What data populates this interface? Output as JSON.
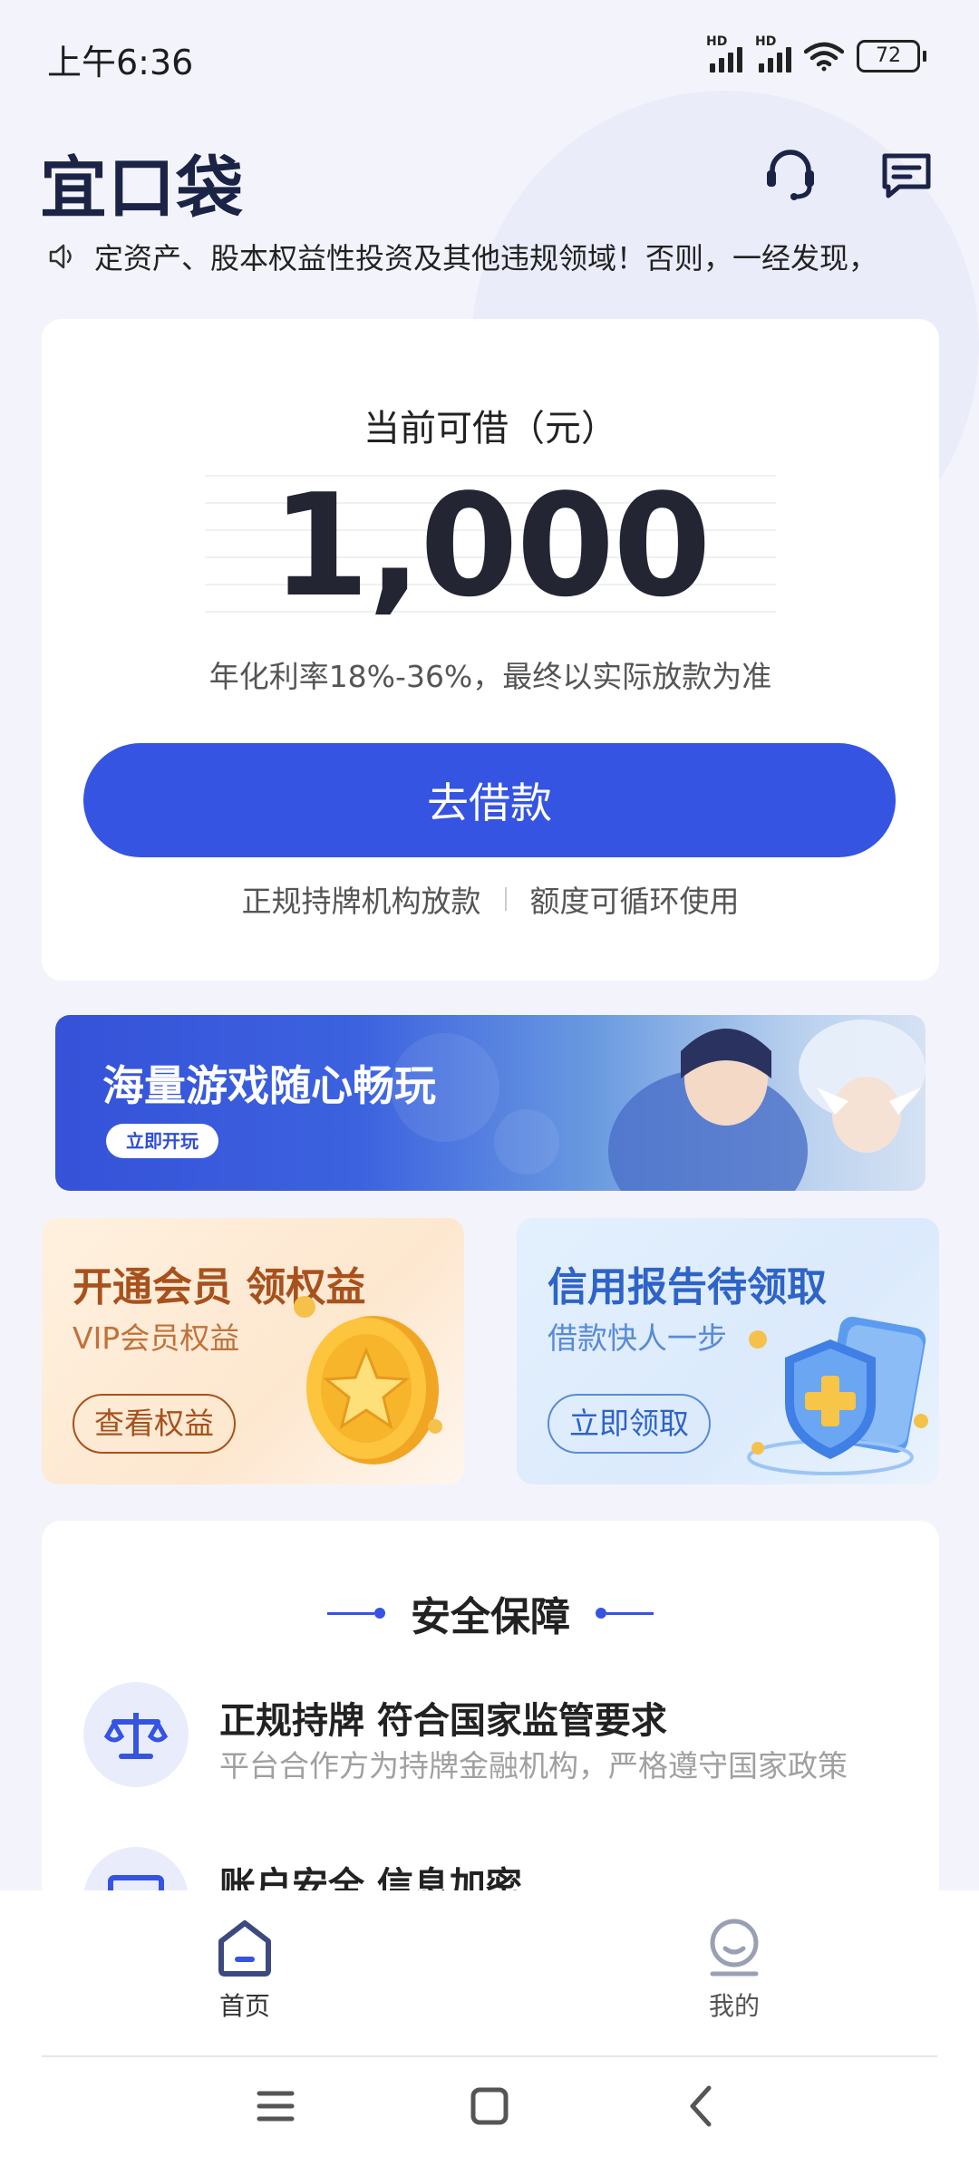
{
  "status_bar": {
    "time": "上午6:36",
    "hd_label": "HD",
    "battery": "72",
    "icons": [
      "signal-1-icon",
      "signal-2-icon",
      "wifi-icon",
      "battery-icon"
    ]
  },
  "header": {
    "logo": "宜口袋",
    "icons": [
      "customer-service-icon",
      "message-icon"
    ]
  },
  "notice": {
    "icon": "speaker-icon",
    "text": "定资产、股本权益性投资及其他违规领域！否则，一经发现，"
  },
  "loan_card": {
    "title": "当前可借（元）",
    "amount": "1,000",
    "rate_text": "年化利率18%-36%，最终以实际放款为准",
    "button_label": "去借款",
    "feature_1": "正规持牌机构放款",
    "feature_2": "额度可循环使用"
  },
  "game_banner": {
    "title": "海量游戏随心畅玩",
    "button_label": "立即开玩"
  },
  "promos": {
    "vip": {
      "title": "开通会员 领权益",
      "subtitle": "VIP会员权益",
      "button_label": "查看权益",
      "icon": "gold-coin-star-icon"
    },
    "credit": {
      "title": "信用报告待领取",
      "subtitle": "借款快人一步",
      "button_label": "立即领取",
      "icon": "shield-plus-icon"
    }
  },
  "security": {
    "title": "安全保障",
    "items": [
      {
        "title": "正规持牌 符合国家监管要求",
        "desc": "平台合作方为持牌金融机构，严格遵守国家政策",
        "icon": "scale-icon"
      },
      {
        "title": "账户安全 信息加密",
        "desc": "",
        "icon": "id-card-icon"
      }
    ]
  },
  "tabbar": {
    "home_label": "首页",
    "mine_label": "我的",
    "active_tab": "首页",
    "colors": {
      "active": "#3554e2",
      "inactive": "#9aa0b3"
    }
  },
  "nav_bar": {
    "icons": [
      "menu-icon",
      "home-square-icon",
      "back-icon"
    ]
  },
  "colors": {
    "primary": "#3554e2",
    "background": "#f3f4fb",
    "vip_accent": "#a8511d",
    "credit_accent": "#2e63c7"
  }
}
